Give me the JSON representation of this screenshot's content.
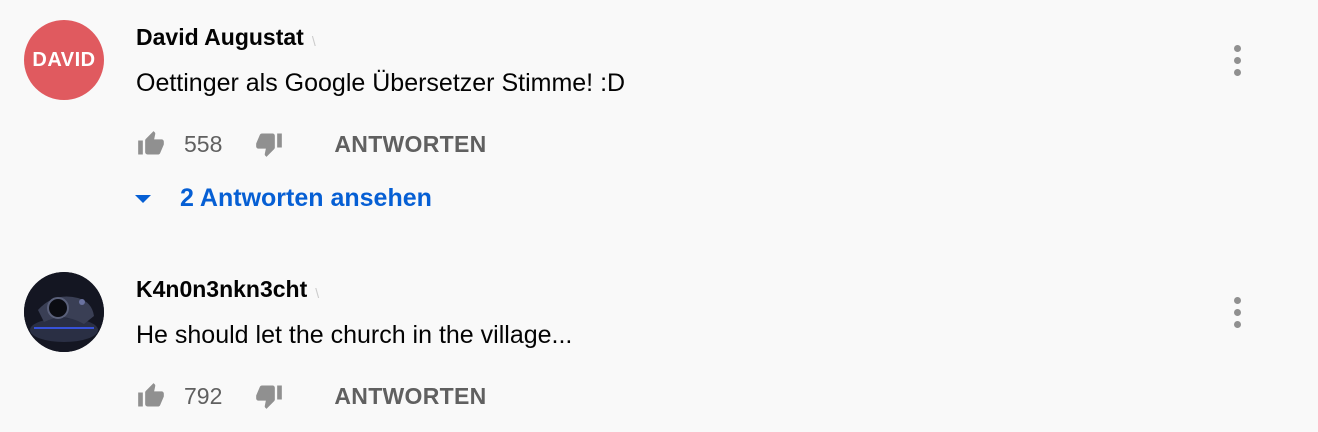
{
  "comments": [
    {
      "author": "David Augustat",
      "avatar_text": "DAVID",
      "avatar_color": "#e05a5f",
      "text": "Oettinger als Google Übersetzer Stimme! :D",
      "likes": "558",
      "reply_label": "ANTWORTEN",
      "replies_label": "2 Antworten ansehen"
    },
    {
      "author": "K4n0n3nkn3cht",
      "avatar_color": "#1b1d2a",
      "text": "He should let the church in the village...",
      "likes": "792",
      "reply_label": "ANTWORTEN"
    }
  ],
  "colors": {
    "background": "#f9f9f9",
    "link": "#065fd4",
    "secondary_text": "#606060",
    "icon": "#909090"
  }
}
